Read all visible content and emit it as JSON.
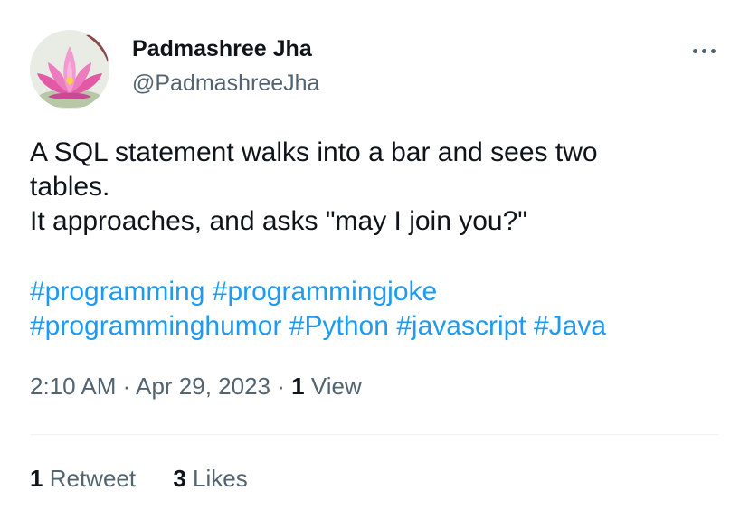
{
  "user": {
    "display_name": "Padmashree Jha",
    "handle": "@PadmashreeJha",
    "avatar_icon": "lotus-flower-avatar"
  },
  "tweet": {
    "lines": [
      "A SQL statement walks into a bar and sees two",
      "tables.",
      "It approaches, and asks \"may I join you?\""
    ],
    "hashtags": [
      [
        "#programming",
        "#programmingjoke"
      ],
      [
        "#programminghumor",
        "#Python",
        "#javascript",
        "#Java"
      ]
    ]
  },
  "meta": {
    "time": "2:10 AM",
    "separator": "·",
    "date": "Apr 29, 2023",
    "views_count": "1",
    "views_label": "View"
  },
  "stats": {
    "retweets_count": "1",
    "retweets_label": "Retweet",
    "likes_count": "3",
    "likes_label": "Likes"
  },
  "colors": {
    "link": "#1d9bf0",
    "secondary_text": "#536471",
    "primary_text": "#0f1419",
    "divider": "#eff3f4"
  },
  "icons": {
    "more": "more-horizontal-icon"
  }
}
